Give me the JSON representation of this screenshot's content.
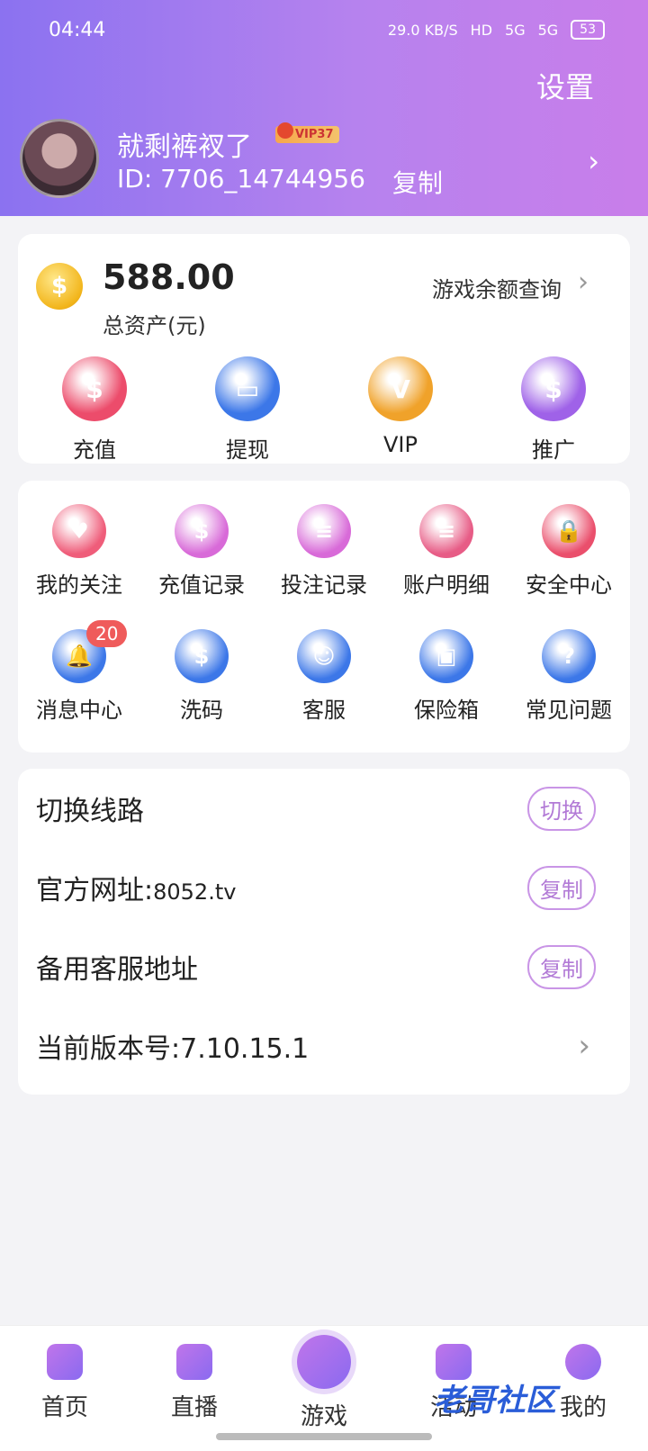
{
  "status_bar": {
    "time": "04:44",
    "net_speed": "29.0 KB/S",
    "hd": "HD",
    "signal1": "5G",
    "signal2": "5G",
    "battery": "53"
  },
  "header": {
    "settings_label": "设置",
    "username": "就剩裤衩了",
    "vip_badge": "VIP37",
    "id_text": "ID:  7706_14744956",
    "copy_label": "复制"
  },
  "wallet": {
    "balance": "588.00",
    "balance_label": "总资产(元)",
    "query_label": "游戏余额查询",
    "actions": [
      {
        "label": "充值",
        "icon": "money-bag-icon",
        "color": "#ec4c6b",
        "glyph": "$"
      },
      {
        "label": "提现",
        "icon": "card-icon",
        "color": "#3c77e8",
        "glyph": "▭"
      },
      {
        "label": "VIP",
        "icon": "vip-diamond-icon",
        "color": "#f0a22a",
        "glyph": "V"
      },
      {
        "label": "推广",
        "icon": "promote-bag-icon",
        "color": "#9f62e8",
        "glyph": "$"
      }
    ]
  },
  "menu": {
    "items": [
      {
        "label": "我的关注",
        "icon": "heart-plus-icon",
        "color": "#ef5d7a",
        "glyph": "♥"
      },
      {
        "label": "充值记录",
        "icon": "deposit-record-icon",
        "color": "#d86ad8",
        "glyph": "$"
      },
      {
        "label": "投注记录",
        "icon": "bet-record-icon",
        "color": "#d86ad8",
        "glyph": "≡"
      },
      {
        "label": "账户明细",
        "icon": "account-detail-icon",
        "color": "#e75c86",
        "glyph": "≡"
      },
      {
        "label": "安全中心",
        "icon": "security-lock-icon",
        "color": "#ea4f6c",
        "glyph": "🔒"
      },
      {
        "label": "消息中心",
        "icon": "bell-icon",
        "color": "#3c77e8",
        "glyph": "🔔",
        "badge": "20"
      },
      {
        "label": "洗码",
        "icon": "chip-icon",
        "color": "#3c77e8",
        "glyph": "$"
      },
      {
        "label": "客服",
        "icon": "headset-icon",
        "color": "#3c77e8",
        "glyph": "☺"
      },
      {
        "label": "保险箱",
        "icon": "safe-icon",
        "color": "#3c77e8",
        "glyph": "▣"
      },
      {
        "label": "常见问题",
        "icon": "question-icon",
        "color": "#3c77e8",
        "glyph": "?"
      }
    ]
  },
  "settings_list": {
    "switch_line": {
      "label": "切换线路",
      "button": "切换"
    },
    "official_site": {
      "label": "官方网址:",
      "value": "8052.tv",
      "button": "复制"
    },
    "backup_cs": {
      "label": "备用客服地址",
      "button": "复制"
    },
    "version": {
      "label": "当前版本号:",
      "value": "7.10.15.1"
    }
  },
  "tabbar": {
    "items": [
      {
        "label": "首页",
        "icon": "home-icon"
      },
      {
        "label": "直播",
        "icon": "live-video-icon"
      },
      {
        "label": "游戏",
        "icon": "gamepad-icon"
      },
      {
        "label": "活动",
        "icon": "activity-icon"
      },
      {
        "label": "我的",
        "icon": "smile-icon"
      }
    ]
  },
  "watermark": "老哥社区"
}
